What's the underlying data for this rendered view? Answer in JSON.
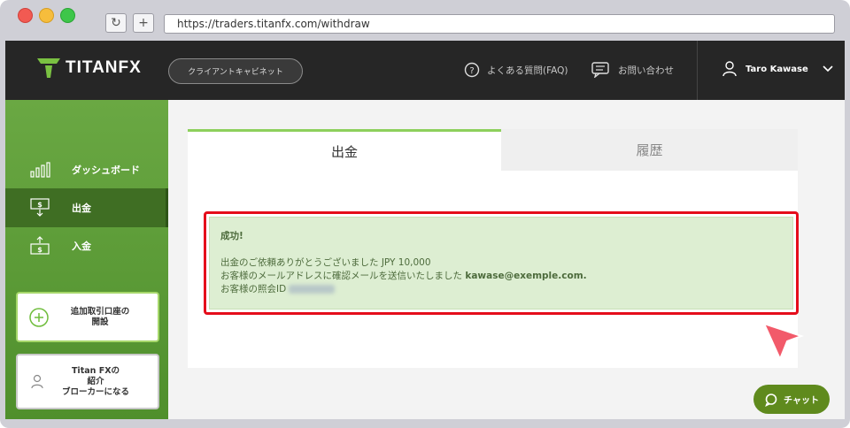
{
  "browser": {
    "url": "https://traders.titanfx.com/withdraw"
  },
  "header": {
    "logo": "TITANFX",
    "client_cabinet": "クライアントキャビネット",
    "faq": "よくある質問(FAQ)",
    "contact": "お問い合わせ",
    "user_name": "Taro Kawase"
  },
  "sidebar": {
    "items": [
      {
        "label": "ダッシュボード",
        "icon": "bar-chart-icon"
      },
      {
        "label": "出金",
        "icon": "withdraw-icon"
      },
      {
        "label": "入金",
        "icon": "deposit-icon"
      }
    ],
    "add_account": {
      "line1": "追加取引口座の",
      "line2": "開設"
    },
    "referral": {
      "line1": "Titan FXの",
      "line2": "紹介",
      "line3": "ブローカーになる"
    }
  },
  "tabs": [
    "出金",
    "履歴"
  ],
  "alert": {
    "title": "成功!",
    "line1": "出金のご依頼ありがとうございました JPY 10,000",
    "line2_prefix": "お客様のメールアドレスに確認メールを送信いたしました ",
    "line2_email": "kawase@exemple.com.",
    "line3": "お客様の照会ID"
  },
  "chat": "チャット",
  "colors": {
    "accent_green": "#8dd05c",
    "alert_border": "#e50d1b",
    "header_bg": "#262626"
  }
}
